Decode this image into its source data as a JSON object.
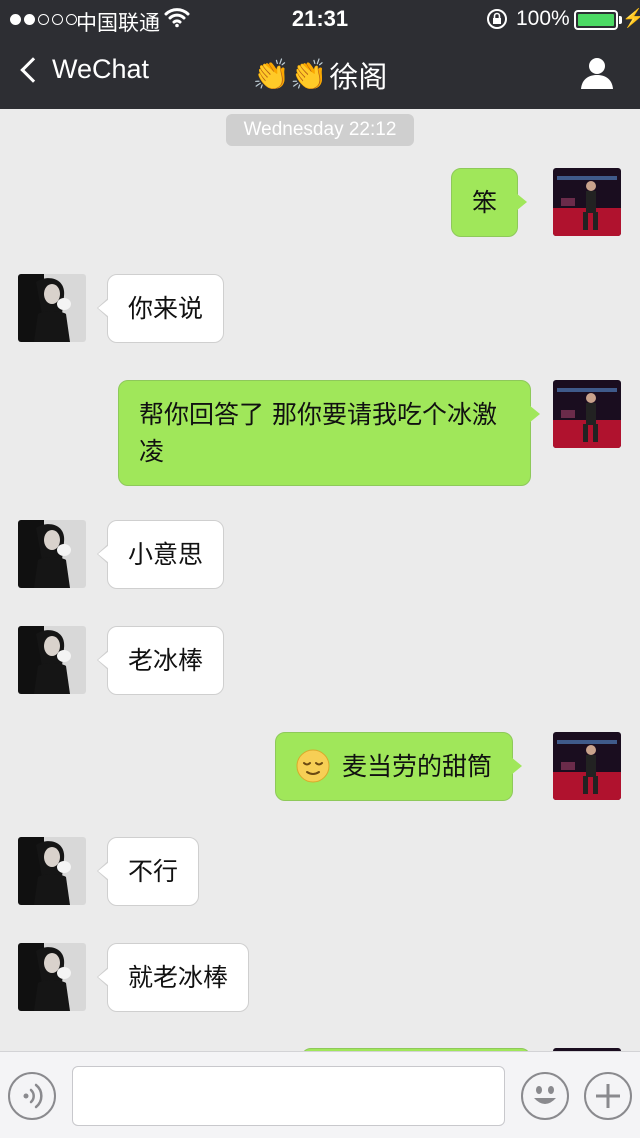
{
  "status_bar": {
    "carrier": "中国联通",
    "time": "21:31",
    "battery": "100%",
    "signal_bars_filled": 2,
    "signal_bars_total": 5,
    "icons": [
      "wifi-icon",
      "rotation-lock-icon",
      "battery-icon",
      "charging-icon"
    ]
  },
  "nav": {
    "back_label": "WeChat",
    "title_emoji": "👏👏",
    "title": "徐阁",
    "icons": [
      "chevron-left-icon",
      "profile-icon"
    ]
  },
  "chat": {
    "timestamp": "Wednesday 22:12",
    "messages": [
      {
        "sender": "me",
        "text": "笨"
      },
      {
        "sender": "them",
        "text": "你来说"
      },
      {
        "sender": "me",
        "text": "帮你回答了 那你要请我吃个冰激凌"
      },
      {
        "sender": "them",
        "text": "小意思"
      },
      {
        "sender": "them",
        "text": "老冰棒"
      },
      {
        "sender": "me",
        "emoji": "relieved-face-icon",
        "text": "麦当劳的甜筒"
      },
      {
        "sender": "them",
        "text": "不行"
      },
      {
        "sender": "them",
        "text": "就老冰棒"
      },
      {
        "sender": "me",
        "text": ""
      }
    ]
  },
  "input_bar": {
    "message_value": "",
    "icons": [
      "voice-icon",
      "emoji-icon",
      "plus-icon"
    ]
  },
  "colors": {
    "header_bg": "#2d2e33",
    "chat_bg": "#ebebeb",
    "my_bubble": "#a0e75a",
    "their_bubble": "#ffffff",
    "battery_fill": "#4cd964"
  }
}
